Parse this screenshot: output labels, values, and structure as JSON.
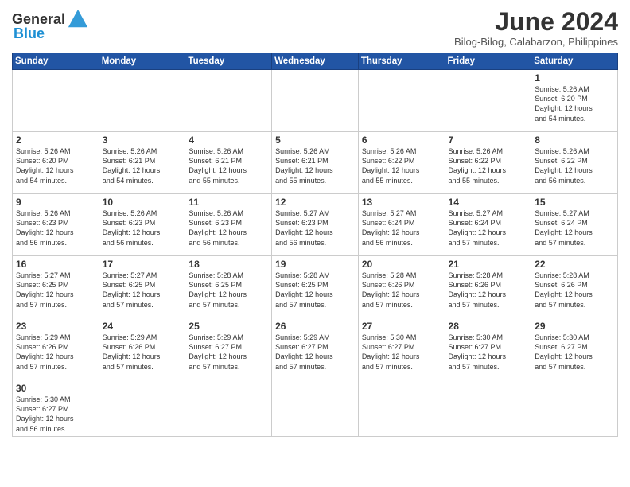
{
  "header": {
    "logo_general": "General",
    "logo_blue": "Blue",
    "month_year": "June 2024",
    "location": "Bilog-Bilog, Calabarzon, Philippines"
  },
  "days_of_week": [
    "Sunday",
    "Monday",
    "Tuesday",
    "Wednesday",
    "Thursday",
    "Friday",
    "Saturday"
  ],
  "weeks": [
    [
      {
        "day": "",
        "info": ""
      },
      {
        "day": "",
        "info": ""
      },
      {
        "day": "",
        "info": ""
      },
      {
        "day": "",
        "info": ""
      },
      {
        "day": "",
        "info": ""
      },
      {
        "day": "",
        "info": ""
      },
      {
        "day": "1",
        "info": "Sunrise: 5:26 AM\nSunset: 6:20 PM\nDaylight: 12 hours\nand 54 minutes."
      }
    ],
    [
      {
        "day": "2",
        "info": "Sunrise: 5:26 AM\nSunset: 6:20 PM\nDaylight: 12 hours\nand 54 minutes."
      },
      {
        "day": "3",
        "info": "Sunrise: 5:26 AM\nSunset: 6:21 PM\nDaylight: 12 hours\nand 54 minutes."
      },
      {
        "day": "4",
        "info": "Sunrise: 5:26 AM\nSunset: 6:21 PM\nDaylight: 12 hours\nand 55 minutes."
      },
      {
        "day": "5",
        "info": "Sunrise: 5:26 AM\nSunset: 6:21 PM\nDaylight: 12 hours\nand 55 minutes."
      },
      {
        "day": "6",
        "info": "Sunrise: 5:26 AM\nSunset: 6:22 PM\nDaylight: 12 hours\nand 55 minutes."
      },
      {
        "day": "7",
        "info": "Sunrise: 5:26 AM\nSunset: 6:22 PM\nDaylight: 12 hours\nand 55 minutes."
      },
      {
        "day": "8",
        "info": "Sunrise: 5:26 AM\nSunset: 6:22 PM\nDaylight: 12 hours\nand 56 minutes."
      }
    ],
    [
      {
        "day": "9",
        "info": "Sunrise: 5:26 AM\nSunset: 6:23 PM\nDaylight: 12 hours\nand 56 minutes."
      },
      {
        "day": "10",
        "info": "Sunrise: 5:26 AM\nSunset: 6:23 PM\nDaylight: 12 hours\nand 56 minutes."
      },
      {
        "day": "11",
        "info": "Sunrise: 5:26 AM\nSunset: 6:23 PM\nDaylight: 12 hours\nand 56 minutes."
      },
      {
        "day": "12",
        "info": "Sunrise: 5:27 AM\nSunset: 6:23 PM\nDaylight: 12 hours\nand 56 minutes."
      },
      {
        "day": "13",
        "info": "Sunrise: 5:27 AM\nSunset: 6:24 PM\nDaylight: 12 hours\nand 56 minutes."
      },
      {
        "day": "14",
        "info": "Sunrise: 5:27 AM\nSunset: 6:24 PM\nDaylight: 12 hours\nand 57 minutes."
      },
      {
        "day": "15",
        "info": "Sunrise: 5:27 AM\nSunset: 6:24 PM\nDaylight: 12 hours\nand 57 minutes."
      }
    ],
    [
      {
        "day": "16",
        "info": "Sunrise: 5:27 AM\nSunset: 6:25 PM\nDaylight: 12 hours\nand 57 minutes."
      },
      {
        "day": "17",
        "info": "Sunrise: 5:27 AM\nSunset: 6:25 PM\nDaylight: 12 hours\nand 57 minutes."
      },
      {
        "day": "18",
        "info": "Sunrise: 5:28 AM\nSunset: 6:25 PM\nDaylight: 12 hours\nand 57 minutes."
      },
      {
        "day": "19",
        "info": "Sunrise: 5:28 AM\nSunset: 6:25 PM\nDaylight: 12 hours\nand 57 minutes."
      },
      {
        "day": "20",
        "info": "Sunrise: 5:28 AM\nSunset: 6:26 PM\nDaylight: 12 hours\nand 57 minutes."
      },
      {
        "day": "21",
        "info": "Sunrise: 5:28 AM\nSunset: 6:26 PM\nDaylight: 12 hours\nand 57 minutes."
      },
      {
        "day": "22",
        "info": "Sunrise: 5:28 AM\nSunset: 6:26 PM\nDaylight: 12 hours\nand 57 minutes."
      }
    ],
    [
      {
        "day": "23",
        "info": "Sunrise: 5:29 AM\nSunset: 6:26 PM\nDaylight: 12 hours\nand 57 minutes."
      },
      {
        "day": "24",
        "info": "Sunrise: 5:29 AM\nSunset: 6:26 PM\nDaylight: 12 hours\nand 57 minutes."
      },
      {
        "day": "25",
        "info": "Sunrise: 5:29 AM\nSunset: 6:27 PM\nDaylight: 12 hours\nand 57 minutes."
      },
      {
        "day": "26",
        "info": "Sunrise: 5:29 AM\nSunset: 6:27 PM\nDaylight: 12 hours\nand 57 minutes."
      },
      {
        "day": "27",
        "info": "Sunrise: 5:30 AM\nSunset: 6:27 PM\nDaylight: 12 hours\nand 57 minutes."
      },
      {
        "day": "28",
        "info": "Sunrise: 5:30 AM\nSunset: 6:27 PM\nDaylight: 12 hours\nand 57 minutes."
      },
      {
        "day": "29",
        "info": "Sunrise: 5:30 AM\nSunset: 6:27 PM\nDaylight: 12 hours\nand 57 minutes."
      }
    ],
    [
      {
        "day": "30",
        "info": "Sunrise: 5:30 AM\nSunset: 6:27 PM\nDaylight: 12 hours\nand 56 minutes."
      },
      {
        "day": "",
        "info": ""
      },
      {
        "day": "",
        "info": ""
      },
      {
        "day": "",
        "info": ""
      },
      {
        "day": "",
        "info": ""
      },
      {
        "day": "",
        "info": ""
      },
      {
        "day": "",
        "info": ""
      }
    ]
  ]
}
